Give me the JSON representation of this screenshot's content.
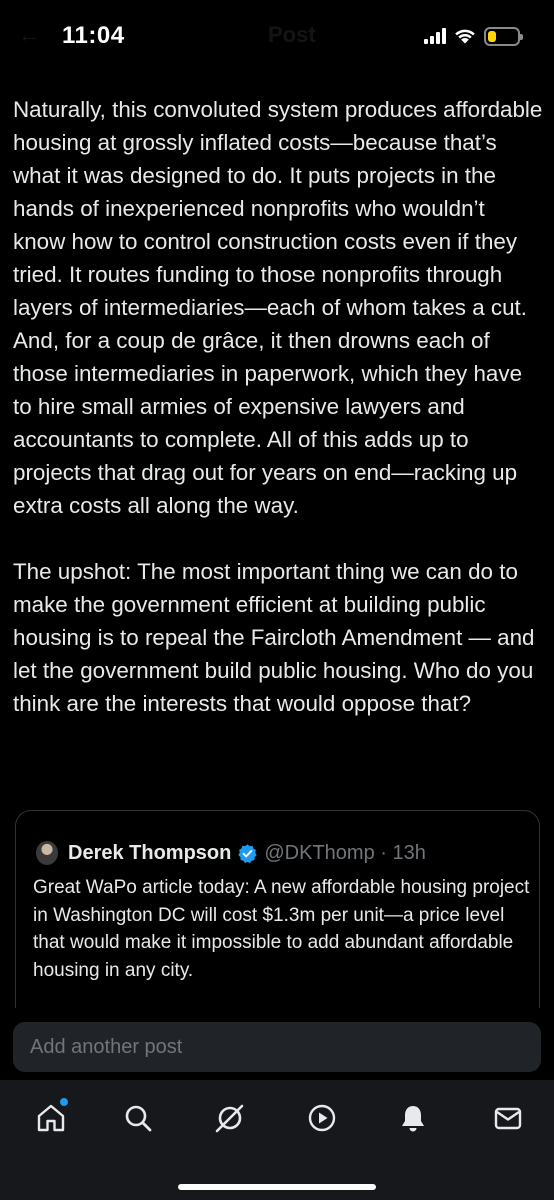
{
  "status_bar": {
    "time": "11:04",
    "battery_level": 0.3,
    "battery_color": "#ffd60a"
  },
  "header": {
    "back_icon": "arrow-left-icon",
    "title": "Post"
  },
  "post": {
    "paragraphs": [
      "Naturally, this convoluted system produces affordable housing at grossly inflated costs—because that’s what it was designed to do. It puts projects in the hands of inexperienced nonprofits who wouldn’t know how to control construction costs even if they tried. It routes funding to those nonprofits through layers of intermediaries—each of whom takes a cut. And, for a coup de grâce, it then drowns each of those intermediaries in paperwork, which they have to hire small armies of expensive lawyers and accountants to complete. All of this adds up to projects that drag out for years on end—racking up extra costs all along the way.",
      "The upshot: The most important thing we can do to make the government efficient at building public housing is to repeal the Faircloth Amendment — and let the government build public housing. Who do you think are the interests that would oppose that?"
    ]
  },
  "quoted_post": {
    "author_name": "Derek Thompson",
    "handle_time": "@DKThomp · 13h",
    "verified_icon": "verified-badge-icon",
    "verified_color": "#1d9bf0",
    "text": "Great WaPo article today: A new affordable housing project in Washington DC will cost $1.3m per unit—a price level that would make it impossible to add abundant affordable housing in any city."
  },
  "reply": {
    "placeholder": "Add another post"
  },
  "tab_bar": {
    "tabs": [
      "home-icon",
      "search-icon",
      "grok-icon",
      "video-icon",
      "notifications-icon",
      "messages-icon"
    ],
    "home_has_notification": true,
    "accent_color": "#1d9bf0"
  }
}
